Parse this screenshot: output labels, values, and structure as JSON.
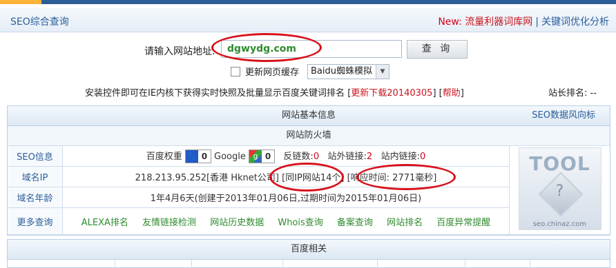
{
  "header": {
    "title": "SEO综合查询",
    "new_label": "New:",
    "link1": "流量利器词库网",
    "separator": "|",
    "link2": "关键词优化分析"
  },
  "query": {
    "label": "请输入网站地址:",
    "url_value": "dgwydg.com",
    "button_label": "查 询"
  },
  "options": {
    "refresh_label": "更新网页缓存",
    "refresh_checked": false,
    "spider_selected": "Baidu蜘蛛模拟"
  },
  "notice": {
    "text": "安装控件即可在IE内核下获得实时快照及批量显示百度关键词排名",
    "download_label": "更新下载20140305",
    "help_label": "帮助",
    "webmaster_rank": "站长排名: --"
  },
  "basic": {
    "title": "网站基本信息",
    "trend_link": "SEO数据风向标",
    "firewall": "网站防火墙",
    "rows": {
      "seo": {
        "key": "SEO信息",
        "baidu_label": "百度权重",
        "baidu_value": "0",
        "google_label": "Google",
        "google_value": "0",
        "backlinks_label": "反链数:",
        "backlinks_value": "0",
        "outlinks_label": "站外链接:",
        "outlinks_value": "2",
        "inlinks_label": "站内链接:",
        "inlinks_value": "0"
      },
      "ip": {
        "key": "域名IP",
        "ip_text": "218.213.95.252[香港 Hknet公司]",
        "same_ip": "[同IP网站14个]",
        "response": "[响应时间: 2771毫秒]"
      },
      "age": {
        "key": "域名年龄",
        "value": "1年4月6天",
        "detail": "(创建于2013年01月06日,过期时间为2015年01月06日)"
      },
      "more": {
        "key": "更多查询",
        "links": [
          "ALEXA排名",
          "友情链接检测",
          "网站历史数据",
          "Whois查询",
          "备案查询",
          "网站排名",
          "百度异常提醒"
        ]
      }
    },
    "logo_word": "TOOL",
    "logo_site": "seo.chinaz.com"
  },
  "baidu": {
    "title": "百度相关"
  },
  "colors": {
    "brand_blue": "#2a5d9a",
    "accent_red": "#d0021b",
    "link_green": "#2e8b2e",
    "ring_red": "#d8111c"
  }
}
